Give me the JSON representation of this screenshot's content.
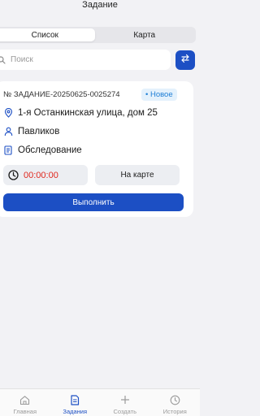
{
  "header": {
    "title": "Задание"
  },
  "segmented": {
    "list_label": "Список",
    "map_label": "Карта"
  },
  "search": {
    "placeholder": "Поиск"
  },
  "task": {
    "number": "№ ЗАДАНИЕ-20250625-0025274",
    "status": "• Новое",
    "address": "1-я Останкинская улица, дом 25",
    "assignee": "Павликов",
    "type": "Обследование",
    "timer": "00:00:00",
    "map_button": "На карте",
    "run_button": "Выполнить"
  },
  "tabbar": {
    "home": "Главная",
    "tasks": "Задания",
    "create": "Создать",
    "history": "История"
  },
  "colors": {
    "accent": "#1c4fc4",
    "badge_bg": "#e4f1fc",
    "badge_text": "#1f7fd6",
    "timer": "#e0281e"
  }
}
